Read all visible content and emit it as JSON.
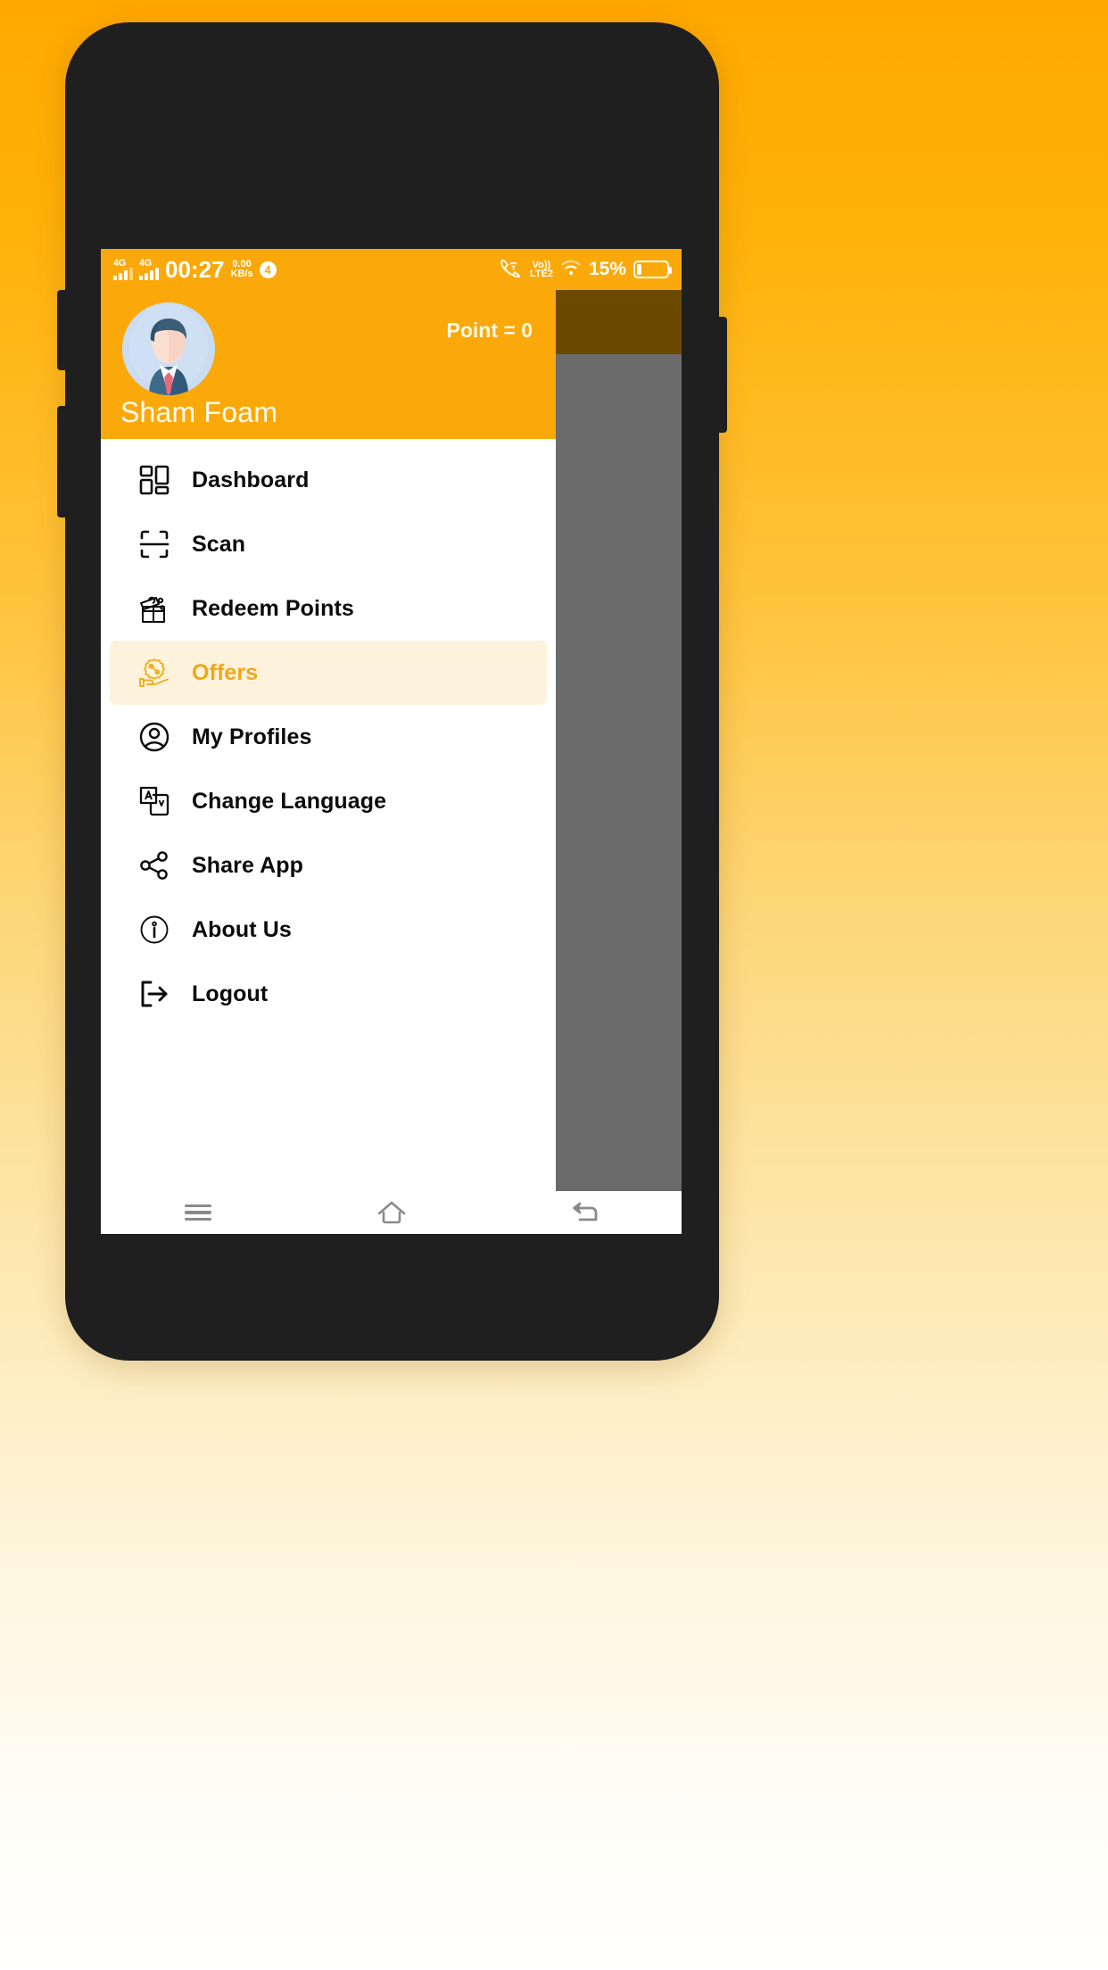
{
  "statusbar": {
    "network_1": "4G",
    "network_2": "4G",
    "time": "00:27",
    "data_rate_value": "0.00",
    "data_rate_unit": "KB/s",
    "notification_count": "4",
    "vowifi_label": "Vo))",
    "volte_label": "LTE2",
    "battery_percent": "15%",
    "icons": [
      "signal-icon",
      "signal-icon",
      "vowifi-icon",
      "wifi-icon",
      "battery-icon"
    ]
  },
  "drawer": {
    "points_label": "Point = 0",
    "user_name": "Sham Foam",
    "avatar_icon": "user-avatar-illustration",
    "header_color": "#FBA90A",
    "active_bg_color": "#FDF2DC",
    "active_text_color": "#EFA81B",
    "items": [
      {
        "label": "Dashboard",
        "icon": "dashboard-grid-icon",
        "active": false
      },
      {
        "label": "Scan",
        "icon": "qr-scan-icon",
        "active": false
      },
      {
        "label": "Redeem Points",
        "icon": "gift-box-icon",
        "active": false
      },
      {
        "label": "Offers",
        "icon": "offer-percent-hand-icon",
        "active": true
      },
      {
        "label": "My Profiles",
        "icon": "user-circle-icon",
        "active": false
      },
      {
        "label": "Change Language",
        "icon": "translate-icon",
        "active": false
      },
      {
        "label": "Share App",
        "icon": "share-nodes-icon",
        "active": false
      },
      {
        "label": "About Us",
        "icon": "info-circle-icon",
        "active": false
      },
      {
        "label": "Logout",
        "icon": "logout-arrow-icon",
        "active": false
      }
    ]
  },
  "navbar": {
    "recents_icon": "menu-hamburger-icon",
    "home_icon": "home-icon",
    "back_icon": "back-arrow-icon"
  }
}
